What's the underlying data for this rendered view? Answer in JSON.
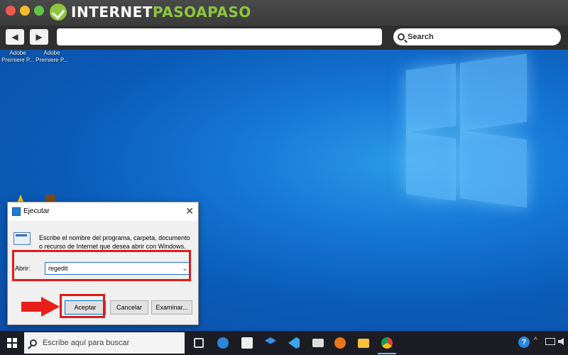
{
  "browser": {
    "logo_part1": "INTERNET",
    "logo_part2": "PASOAPASO",
    "search_placeholder": "Search",
    "back_glyph": "◀",
    "forward_glyph": "▶"
  },
  "desktop": {
    "icons": [
      {
        "label": "Adobe Premiere P..."
      },
      {
        "label": "Adobe Premiere P..."
      }
    ]
  },
  "run_dialog": {
    "title": "Ejecutar",
    "close_glyph": "✕",
    "description": "Escribe el nombre del programa, carpeta, documento o recurso de Internet que desea abrir con Windows.",
    "open_label": "Abrir:",
    "open_value": "regedit",
    "dropdown_glyph": "⌄",
    "ok_label": "Aceptar",
    "cancel_label": "Cancelar",
    "browse_label": "Examinar..."
  },
  "taskbar": {
    "search_placeholder": "Escribe aquí para buscar",
    "help_glyph": "?",
    "chevron_glyph": "^"
  },
  "colors": {
    "highlight": "#e01a1a",
    "logo_green": "#8cc63f",
    "desktop_blue": "#1577d6"
  },
  "icons": [
    "start-icon",
    "taskview-icon",
    "edge-icon",
    "store-icon",
    "dropbox-icon",
    "vscode-icon",
    "mail-icon",
    "firefox-icon",
    "files-icon",
    "chrome-icon",
    "help-icon",
    "network-icon",
    "volume-icon"
  ]
}
